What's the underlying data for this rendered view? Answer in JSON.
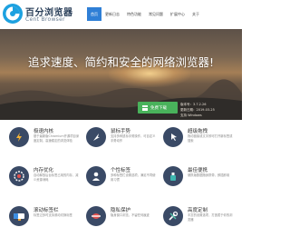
{
  "brand": {
    "name_cn": "百分浏览器",
    "name_en": "Cent Browser"
  },
  "nav": {
    "items": [
      {
        "label": "首页",
        "active": true
      },
      {
        "label": "更新日志",
        "active": false
      },
      {
        "label": "特色功能",
        "active": false
      },
      {
        "label": "常见问题",
        "active": false
      },
      {
        "label": "扩展中心",
        "active": false
      },
      {
        "label": "关于",
        "active": false
      }
    ]
  },
  "hero": {
    "tagline": "追求速度、简约和安全的网络浏览器!",
    "download_label": "免费下载",
    "version_lines": [
      "版本号：3.7.2.26",
      "更新日期：2019-03-25",
      "支持 Windows"
    ]
  },
  "features": [
    {
      "title": "极速内核",
      "desc": "基于最新版Chromium开源项目深度定制，高速稳定的浏览体验"
    },
    {
      "title": "鼠标手势",
      "desc": "支持多种鼠标手势操作，可自定义手势动作"
    },
    {
      "title": "超级拖拽",
      "desc": "拖动链接或文字即可打开新标签或搜索"
    },
    {
      "title": "内存优化",
      "desc": "自动释放后台标签占用的内存，减少资源消耗"
    },
    {
      "title": "个性标签",
      "desc": "多种标签栏设置选项，满足不同使用习惯"
    },
    {
      "title": "最佳便携",
      "desc": "便携版数据随身携带，即插即用"
    },
    {
      "title": "滚动标签栏",
      "desc": "标签过多时支持滚动切换标签"
    },
    {
      "title": "隐私保护",
      "desc": "隐身窗口浏览，不留任何痕迹"
    },
    {
      "title": "高度定制",
      "desc": "丰富的设置选项，打造属于你的浏览器"
    }
  ],
  "icons": [
    "lightning-icon",
    "mouse-gesture-icon",
    "drag-icon",
    "memory-icon",
    "user-icon",
    "portable-icon",
    "scroll-tabs-icon",
    "privacy-icon",
    "tools-icon"
  ],
  "colors": {
    "accent": "#2f7fd6",
    "download": "#49b25b",
    "icon_bg": "#3a4a66"
  }
}
